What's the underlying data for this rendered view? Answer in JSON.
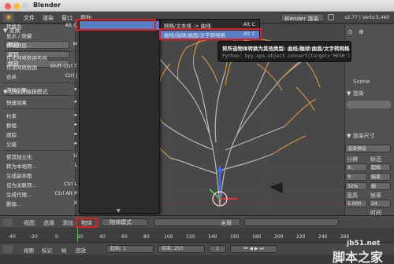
{
  "window": {
    "title": "Blender"
  },
  "infobar": {
    "menus": [
      "文件",
      "渲染",
      "窗口",
      "帮助"
    ],
    "render_engine": "Blender 渲染",
    "version_info": "v2.77 | Verts:5,460"
  },
  "left_panel": {
    "section_transform": "▼ 变换",
    "move": "移动",
    "rotate": "旋转",
    "scale": "缩放",
    "toggle_edit": "▼ 切换到编辑模式"
  },
  "object_menu": {
    "items": [
      {
        "label": "转换为",
        "shortcut": "Alt C",
        "highlighted": true
      },
      {
        "label": "显示 / 隐藏",
        "shortcut": ""
      },
      {
        "label": "移动到层...",
        "shortcut": "M"
      },
      {
        "label": "传递网格数据布局",
        "shortcut": ""
      },
      {
        "label": "传递网格数据",
        "shortcut": "Shift Ctrl T"
      },
      {
        "label": "合并",
        "shortcut": "Ctrl J"
      },
      {
        "label": "游戏引擎",
        "shortcut": ""
      },
      {
        "label": "快速效果",
        "shortcut": ""
      },
      {
        "label": "约束",
        "shortcut": ""
      },
      {
        "label": "群组",
        "shortcut": ""
      },
      {
        "label": "跟踪",
        "shortcut": ""
      },
      {
        "label": "父级",
        "shortcut": ""
      },
      {
        "label": "使其独立化",
        "shortcut": "U"
      },
      {
        "label": "转为本地项...",
        "shortcut": "L"
      },
      {
        "label": "生成副本图",
        "shortcut": ""
      },
      {
        "label": "设为关联项...",
        "shortcut": "Ctrl L"
      },
      {
        "label": "生成代理...",
        "shortcut": "Ctrl Alt P"
      },
      {
        "label": "删除...",
        "shortcut": "X"
      }
    ]
  },
  "convert_submenu": {
    "items": [
      {
        "label": "网格/文本线 -> 曲线",
        "shortcut": "Alt C"
      },
      {
        "label": "曲线/融球/曲面/文字转网格",
        "shortcut": "Alt C",
        "highlighted": true
      }
    ]
  },
  "tooltip": {
    "line1": "将所选物体转换为其他类型: 曲线/融球/曲面/文字转网格",
    "line2": "Python: bpy.ops.object.convert(target='MESH')"
  },
  "right_panel": {
    "scene": "Scene",
    "render": "▼ 渲染",
    "render_size": "▼ 渲染尺寸",
    "preset": "渲染预设",
    "resolution": "分辨",
    "frame_range": "帧范",
    "x": "X:",
    "y": "Y:",
    "start": "起始",
    "end": "结束",
    "step": "帧",
    "pct": "50%",
    "aspect": "宽高",
    "x_val": "1.000",
    "y_val": "1.000",
    "fps": "24",
    "frame_rate": "帧率",
    "time_remap": "时间"
  },
  "header3d": {
    "view": "视图",
    "select": "选择",
    "add": "添加",
    "object": "物体",
    "mode": "物体模式",
    "global": "全局"
  },
  "timeline": {
    "ticks": [
      "-40",
      "-20",
      "0",
      "20",
      "40",
      "60",
      "80",
      "100",
      "120",
      "140",
      "160",
      "180",
      "200",
      "220",
      "240",
      "260"
    ],
    "view": "视图",
    "marker": "标记",
    "frame": "帧",
    "playback": "回放",
    "start_label": "起始:",
    "start_val": "1",
    "end_label": "结束:",
    "end_val": "250",
    "current": "1"
  },
  "watermark": {
    "site": "jb51.net",
    "brand": "脚本之家"
  },
  "colors": {
    "accent_blue": "#5580c8",
    "highlight_red": "#e02020",
    "tree_orange": "#f0a040"
  }
}
